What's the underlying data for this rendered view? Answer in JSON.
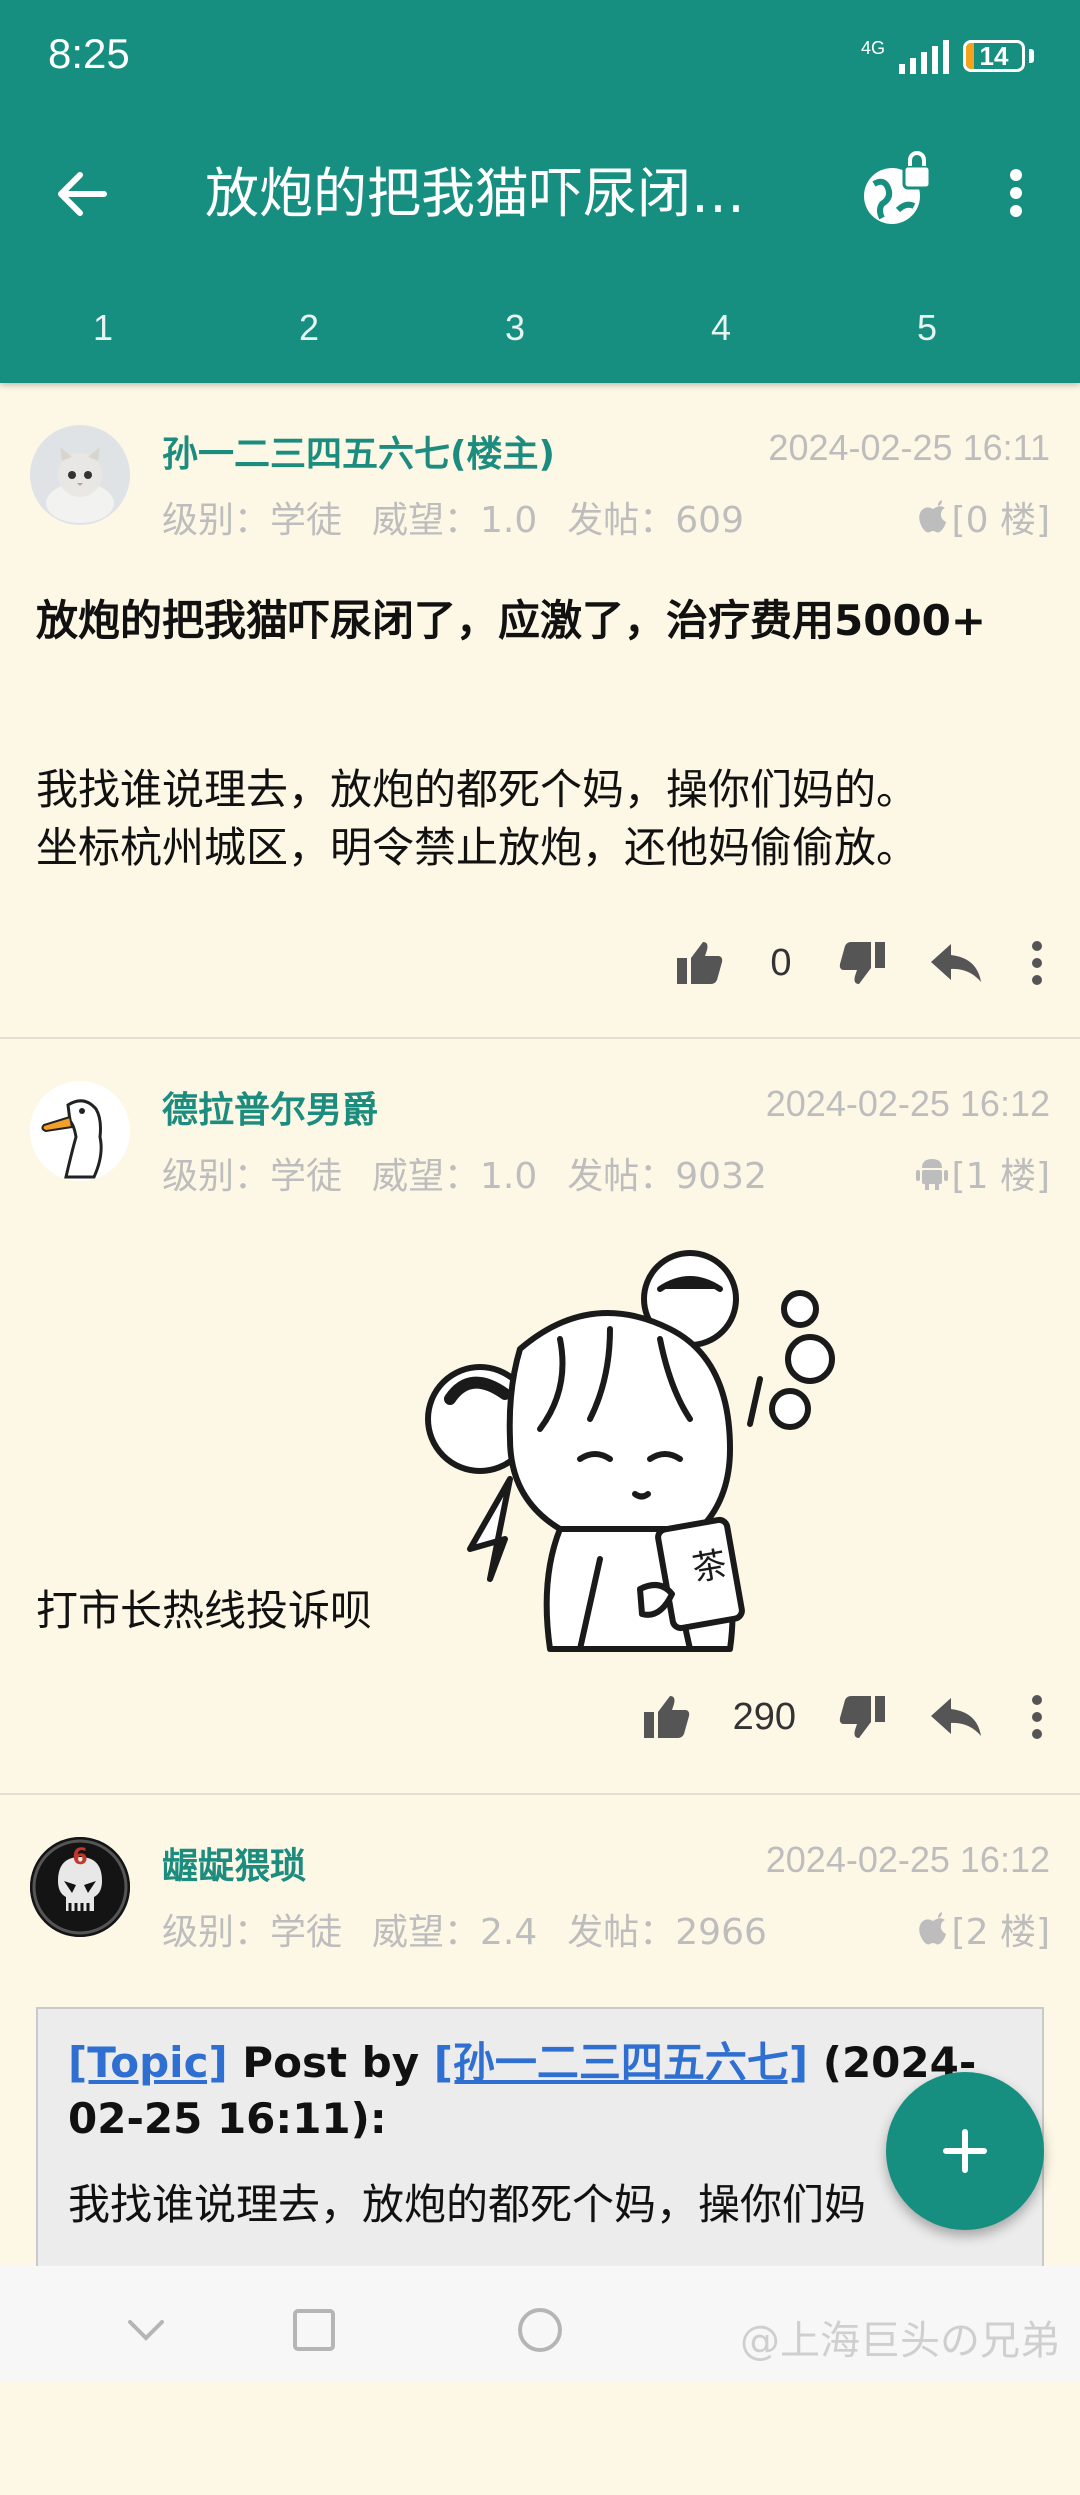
{
  "status": {
    "time": "8:25",
    "network": "4G",
    "battery": "14",
    "battery_level": 0.14
  },
  "toolbar": {
    "title": "放炮的把我猫吓尿闭…"
  },
  "pages": [
    "1",
    "2",
    "3",
    "4",
    "5"
  ],
  "posts": [
    {
      "author": "孙一二三四五六七(楼主)",
      "date": "2024-02-25 16:11",
      "level_label": "级别：学徒",
      "prestige_label": "威望：1.0",
      "posts_label": "发帖：609",
      "floor": "[0 楼]",
      "client": "apple-icon",
      "title": "放炮的把我猫吓尿闭了，应激了，治疗费用5000+",
      "body_lines": [
        "我找谁说理去，放炮的都死个妈，操你们妈的。",
        "坐标杭州城区，明令禁止放炮，还他妈偷偷放。"
      ],
      "likes": "0"
    },
    {
      "author": "德拉普尔男爵",
      "date": "2024-02-25 16:12",
      "level_label": "级别：学徒",
      "prestige_label": "威望：1.0",
      "posts_label": "发帖：9032",
      "floor": "[1 楼]",
      "client": "android-icon",
      "sticker_text": "茶",
      "body": "打市长热线投诉呗",
      "likes": "290"
    },
    {
      "author": "龌龊猥琐",
      "date": "2024-02-25 16:12",
      "level_label": "级别：学徒",
      "prestige_label": "威望：2.4",
      "posts_label": "发帖：2966",
      "floor": "[2 楼]",
      "client": "apple-icon",
      "avatar_text": "6",
      "quote": {
        "topic_link": "[Topic]",
        "post_by": " Post by ",
        "user_link": "[孙一二三四五六七]",
        "time_text": " (2024-02-25 16:11):",
        "body": "我找谁说理去，放炮的都死个妈，操你们妈"
      }
    }
  ],
  "watermark": "@上海巨头の兄弟"
}
